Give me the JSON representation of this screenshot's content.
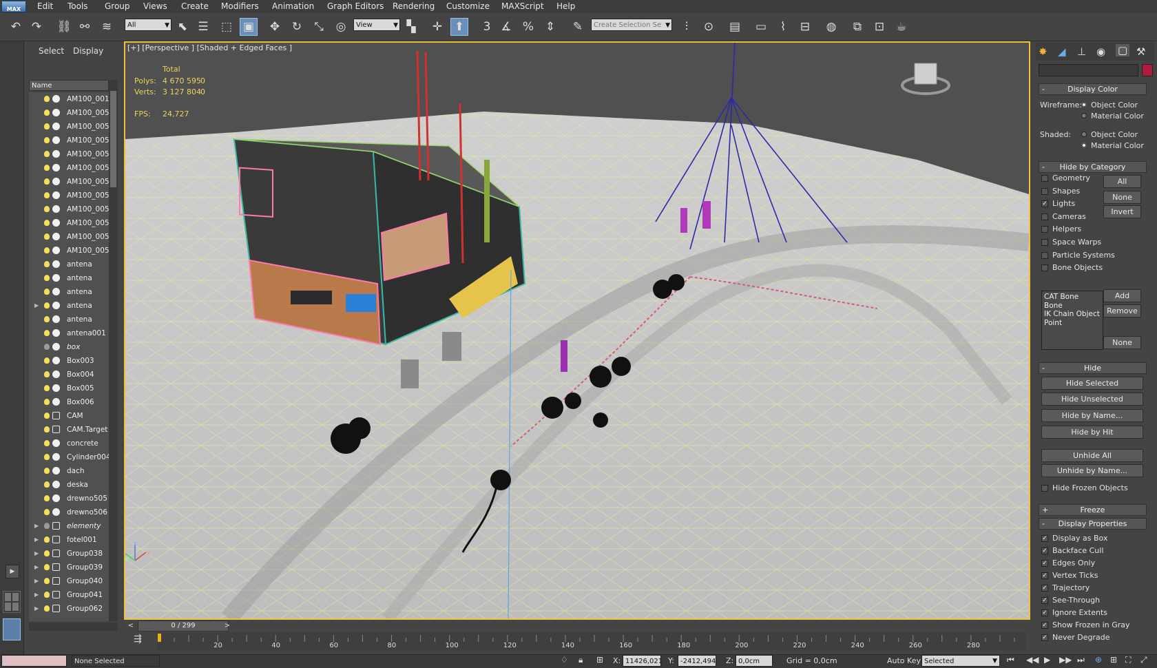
{
  "menu": {
    "logo": "MAX",
    "items": [
      "Edit",
      "Tools",
      "Group",
      "Views",
      "Create",
      "Modifiers",
      "Animation",
      "Graph Editors",
      "Rendering",
      "Customize",
      "MAXScript",
      "Help"
    ]
  },
  "toolbar": {
    "selection_filter": "All",
    "reference_coord": "View",
    "snap_label": "3",
    "selection_set_placeholder": "Create Selection Se"
  },
  "explorer": {
    "tabs": [
      "Select",
      "Display"
    ],
    "column_header": "Name",
    "rows": [
      {
        "name": "AM100_001",
        "exp": false,
        "bulb": "on",
        "type": "obj",
        "italic": false
      },
      {
        "name": "AM100_005",
        "exp": false,
        "bulb": "on",
        "type": "obj",
        "italic": false
      },
      {
        "name": "AM100_005",
        "exp": false,
        "bulb": "on",
        "type": "obj",
        "italic": false
      },
      {
        "name": "AM100_005",
        "exp": false,
        "bulb": "on",
        "type": "obj",
        "italic": false
      },
      {
        "name": "AM100_005",
        "exp": false,
        "bulb": "on",
        "type": "obj",
        "italic": false
      },
      {
        "name": "AM100_005",
        "exp": false,
        "bulb": "on",
        "type": "obj",
        "italic": false
      },
      {
        "name": "AM100_005",
        "exp": false,
        "bulb": "on",
        "type": "obj",
        "italic": false
      },
      {
        "name": "AM100_005",
        "exp": false,
        "bulb": "on",
        "type": "obj",
        "italic": false
      },
      {
        "name": "AM100_005",
        "exp": false,
        "bulb": "on",
        "type": "obj",
        "italic": false
      },
      {
        "name": "AM100_005",
        "exp": false,
        "bulb": "on",
        "type": "obj",
        "italic": false
      },
      {
        "name": "AM100_005",
        "exp": false,
        "bulb": "on",
        "type": "obj",
        "italic": false
      },
      {
        "name": "AM100_005",
        "exp": false,
        "bulb": "on",
        "type": "obj",
        "italic": false
      },
      {
        "name": "antena",
        "exp": false,
        "bulb": "on",
        "type": "obj",
        "italic": false
      },
      {
        "name": "antena",
        "exp": false,
        "bulb": "on",
        "type": "obj",
        "italic": false
      },
      {
        "name": "antena",
        "exp": false,
        "bulb": "on",
        "type": "obj",
        "italic": false
      },
      {
        "name": "antena",
        "exp": true,
        "bulb": "on",
        "type": "obj",
        "italic": false
      },
      {
        "name": "antena",
        "exp": false,
        "bulb": "on",
        "type": "obj",
        "italic": false
      },
      {
        "name": "antena001",
        "exp": false,
        "bulb": "on",
        "type": "obj",
        "italic": false
      },
      {
        "name": "box",
        "exp": false,
        "bulb": "off",
        "type": "obj",
        "italic": true
      },
      {
        "name": "Box003",
        "exp": false,
        "bulb": "on",
        "type": "obj",
        "italic": false
      },
      {
        "name": "Box004",
        "exp": false,
        "bulb": "on",
        "type": "obj",
        "italic": false
      },
      {
        "name": "Box005",
        "exp": false,
        "bulb": "on",
        "type": "obj",
        "italic": false
      },
      {
        "name": "Box006",
        "exp": false,
        "bulb": "on",
        "type": "obj",
        "italic": false
      },
      {
        "name": "CAM",
        "exp": false,
        "bulb": "on",
        "type": "grp",
        "italic": false
      },
      {
        "name": "CAM.Target",
        "exp": false,
        "bulb": "on",
        "type": "grp",
        "italic": false
      },
      {
        "name": "concrete",
        "exp": false,
        "bulb": "on",
        "type": "obj",
        "italic": false
      },
      {
        "name": "Cylinder004",
        "exp": false,
        "bulb": "on",
        "type": "obj",
        "italic": false
      },
      {
        "name": "dach",
        "exp": false,
        "bulb": "on",
        "type": "obj",
        "italic": false
      },
      {
        "name": "deska",
        "exp": false,
        "bulb": "on",
        "type": "obj",
        "italic": false
      },
      {
        "name": "drewno505",
        "exp": false,
        "bulb": "on",
        "type": "obj",
        "italic": false
      },
      {
        "name": "drewno506",
        "exp": false,
        "bulb": "on",
        "type": "obj",
        "italic": false
      },
      {
        "name": "elementy",
        "exp": true,
        "bulb": "off",
        "type": "grp",
        "italic": true
      },
      {
        "name": "fotel001",
        "exp": true,
        "bulb": "on",
        "type": "grp",
        "italic": false
      },
      {
        "name": "Group038",
        "exp": true,
        "bulb": "on",
        "type": "grp",
        "italic": false
      },
      {
        "name": "Group039",
        "exp": true,
        "bulb": "on",
        "type": "grp",
        "italic": false
      },
      {
        "name": "Group040",
        "exp": true,
        "bulb": "on",
        "type": "grp",
        "italic": false
      },
      {
        "name": "Group041",
        "exp": true,
        "bulb": "on",
        "type": "grp",
        "italic": false
      },
      {
        "name": "Group062",
        "exp": true,
        "bulb": "on",
        "type": "grp",
        "italic": false
      }
    ]
  },
  "viewport": {
    "label": "[+] [Perspective ] [Shaded + Edged Faces ]",
    "stats": {
      "total_label": "Total",
      "polys_label": "Polys:",
      "polys_total": "4 670 595",
      "polys_sel": "0",
      "verts_label": "Verts:",
      "verts_total": "3 127 804",
      "verts_sel": "0",
      "fps_label": "FPS:",
      "fps_value": "24,727"
    },
    "axis": {
      "x": "x",
      "y": "y",
      "z": "z"
    }
  },
  "command_panel": {
    "display_color": {
      "title": "Display Color",
      "wireframe_label": "Wireframe:",
      "shaded_label": "Shaded:",
      "option_object": "Object Color",
      "option_material": "Material Color",
      "wireframe_selected": "object",
      "shaded_selected": "material"
    },
    "hide_by_category": {
      "title": "Hide by Category",
      "categories": [
        {
          "label": "Geometry",
          "checked": false
        },
        {
          "label": "Shapes",
          "checked": false
        },
        {
          "label": "Lights",
          "checked": true
        },
        {
          "label": "Cameras",
          "checked": false
        },
        {
          "label": "Helpers",
          "checked": false
        },
        {
          "label": "Space Warps",
          "checked": false
        },
        {
          "label": "Particle Systems",
          "checked": false
        },
        {
          "label": "Bone Objects",
          "checked": false
        }
      ],
      "btn_all": "All",
      "btn_none": "None",
      "btn_invert": "Invert",
      "list_items": [
        "CAT Bone",
        "Bone",
        "IK Chain Object",
        "Point"
      ],
      "btn_add": "Add",
      "btn_remove": "Remove",
      "btn_none2": "None"
    },
    "hide": {
      "title": "Hide",
      "buttons": [
        "Hide Selected",
        "Hide Unselected",
        "Hide by Name...",
        "Hide by Hit",
        "Unhide All",
        "Unhide by Name..."
      ],
      "hide_frozen": "Hide Frozen Objects"
    },
    "freeze": {
      "title": "Freeze"
    },
    "display_properties": {
      "title": "Display Properties",
      "items": [
        "Display as Box",
        "Backface Cull",
        "Edges Only",
        "Vertex Ticks",
        "Trajectory",
        "See-Through",
        "Ignore Extents",
        "Show Frozen in Gray",
        "Never Degrade"
      ]
    }
  },
  "timeline": {
    "position": "0 / 299",
    "ticks": [
      "20",
      "40",
      "60",
      "80",
      "100",
      "120",
      "140",
      "160",
      "180",
      "200",
      "220",
      "240",
      "260",
      "280"
    ]
  },
  "status": {
    "selection": "None Selected",
    "x_label": "X:",
    "x_value": "11426,021",
    "y_label": "Y:",
    "y_value": "-2412,494",
    "z_label": "Z:",
    "z_value": "0,0cm",
    "grid": "Grid = 0,0cm",
    "auto_key": "Auto Key",
    "key_mode": "Selected"
  },
  "colors": {
    "accent": "#f0c23a",
    "selected_tool": "#6a8fb8",
    "bulb": "#f3df5a"
  }
}
